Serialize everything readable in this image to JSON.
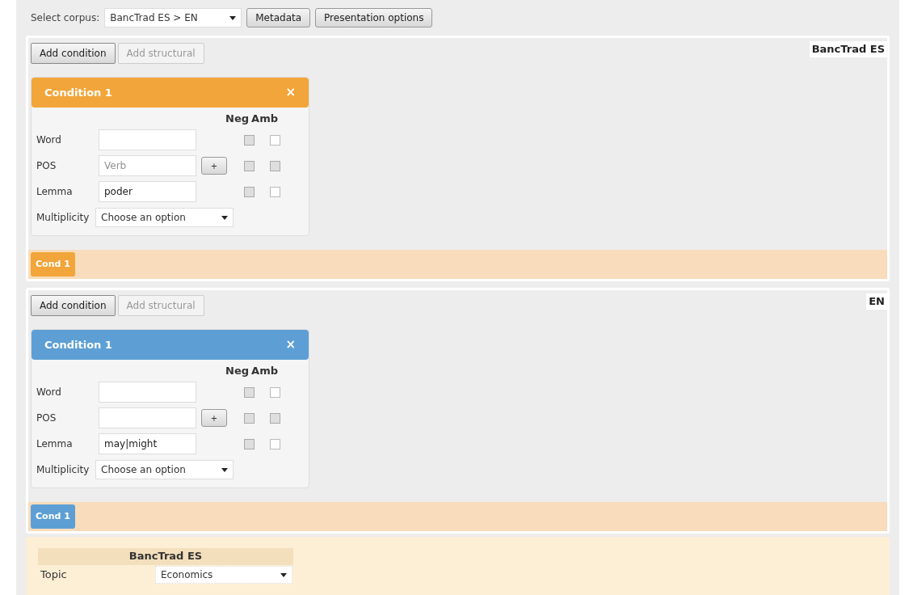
{
  "corpus_select": {
    "label": "Select corpus:",
    "value": "BancTrad ES > EN"
  },
  "toolbar_buttons": [
    "Metadata",
    "Presentation options"
  ],
  "queries": [
    {
      "language": "BancTrad ES",
      "color": "#f2a53a",
      "buttons": [
        {
          "label": "Add condition",
          "disabled": false
        },
        {
          "label": "Add structural",
          "disabled": true
        }
      ],
      "conditions": [
        {
          "title": "Condition 1",
          "close": "×",
          "columns": [
            "Neg",
            "Amb"
          ],
          "rows": [
            {
              "kind": "text",
              "label": "Word",
              "checks": [
                {
                  "disabled": true
                },
                {
                  "disabled": false
                }
              ]
            },
            {
              "kind": "text_plus",
              "label": "POS",
              "placeholder": "Verb",
              "plus": "+",
              "checks": [
                {
                  "disabled": true
                },
                {
                  "disabled": true
                }
              ]
            },
            {
              "kind": "text",
              "label": "Lemma",
              "value": "poder",
              "checks": [
                {
                  "disabled": true
                },
                {
                  "disabled": false
                }
              ]
            },
            {
              "kind": "select",
              "label": "Multiplicity",
              "value": "Choose an option"
            }
          ]
        }
      ],
      "tabs": [
        "Cond 1"
      ]
    },
    {
      "language": "EN",
      "color": "#5d9fd5",
      "buttons": [
        {
          "label": "Add condition",
          "disabled": false
        },
        {
          "label": "Add structural",
          "disabled": true
        }
      ],
      "conditions": [
        {
          "title": "Condition 1",
          "close": "×",
          "columns": [
            "Neg",
            "Amb"
          ],
          "rows": [
            {
              "kind": "text",
              "label": "Word",
              "checks": [
                {
                  "disabled": true
                },
                {
                  "disabled": false
                }
              ]
            },
            {
              "kind": "text_plus",
              "label": "POS",
              "plus": "+",
              "checks": [
                {
                  "disabled": true
                },
                {
                  "disabled": true
                }
              ]
            },
            {
              "kind": "text",
              "label": "Lemma",
              "value": "may|might",
              "checks": [
                {
                  "disabled": true
                },
                {
                  "disabled": false
                }
              ]
            },
            {
              "kind": "select",
              "label": "Multiplicity",
              "value": "Choose an option"
            }
          ]
        }
      ],
      "tabs": [
        "Cond 1"
      ]
    }
  ],
  "metadata": {
    "heading": "BancTrad ES",
    "rows": [
      {
        "label": "Topic",
        "value": "Economics"
      }
    ]
  }
}
